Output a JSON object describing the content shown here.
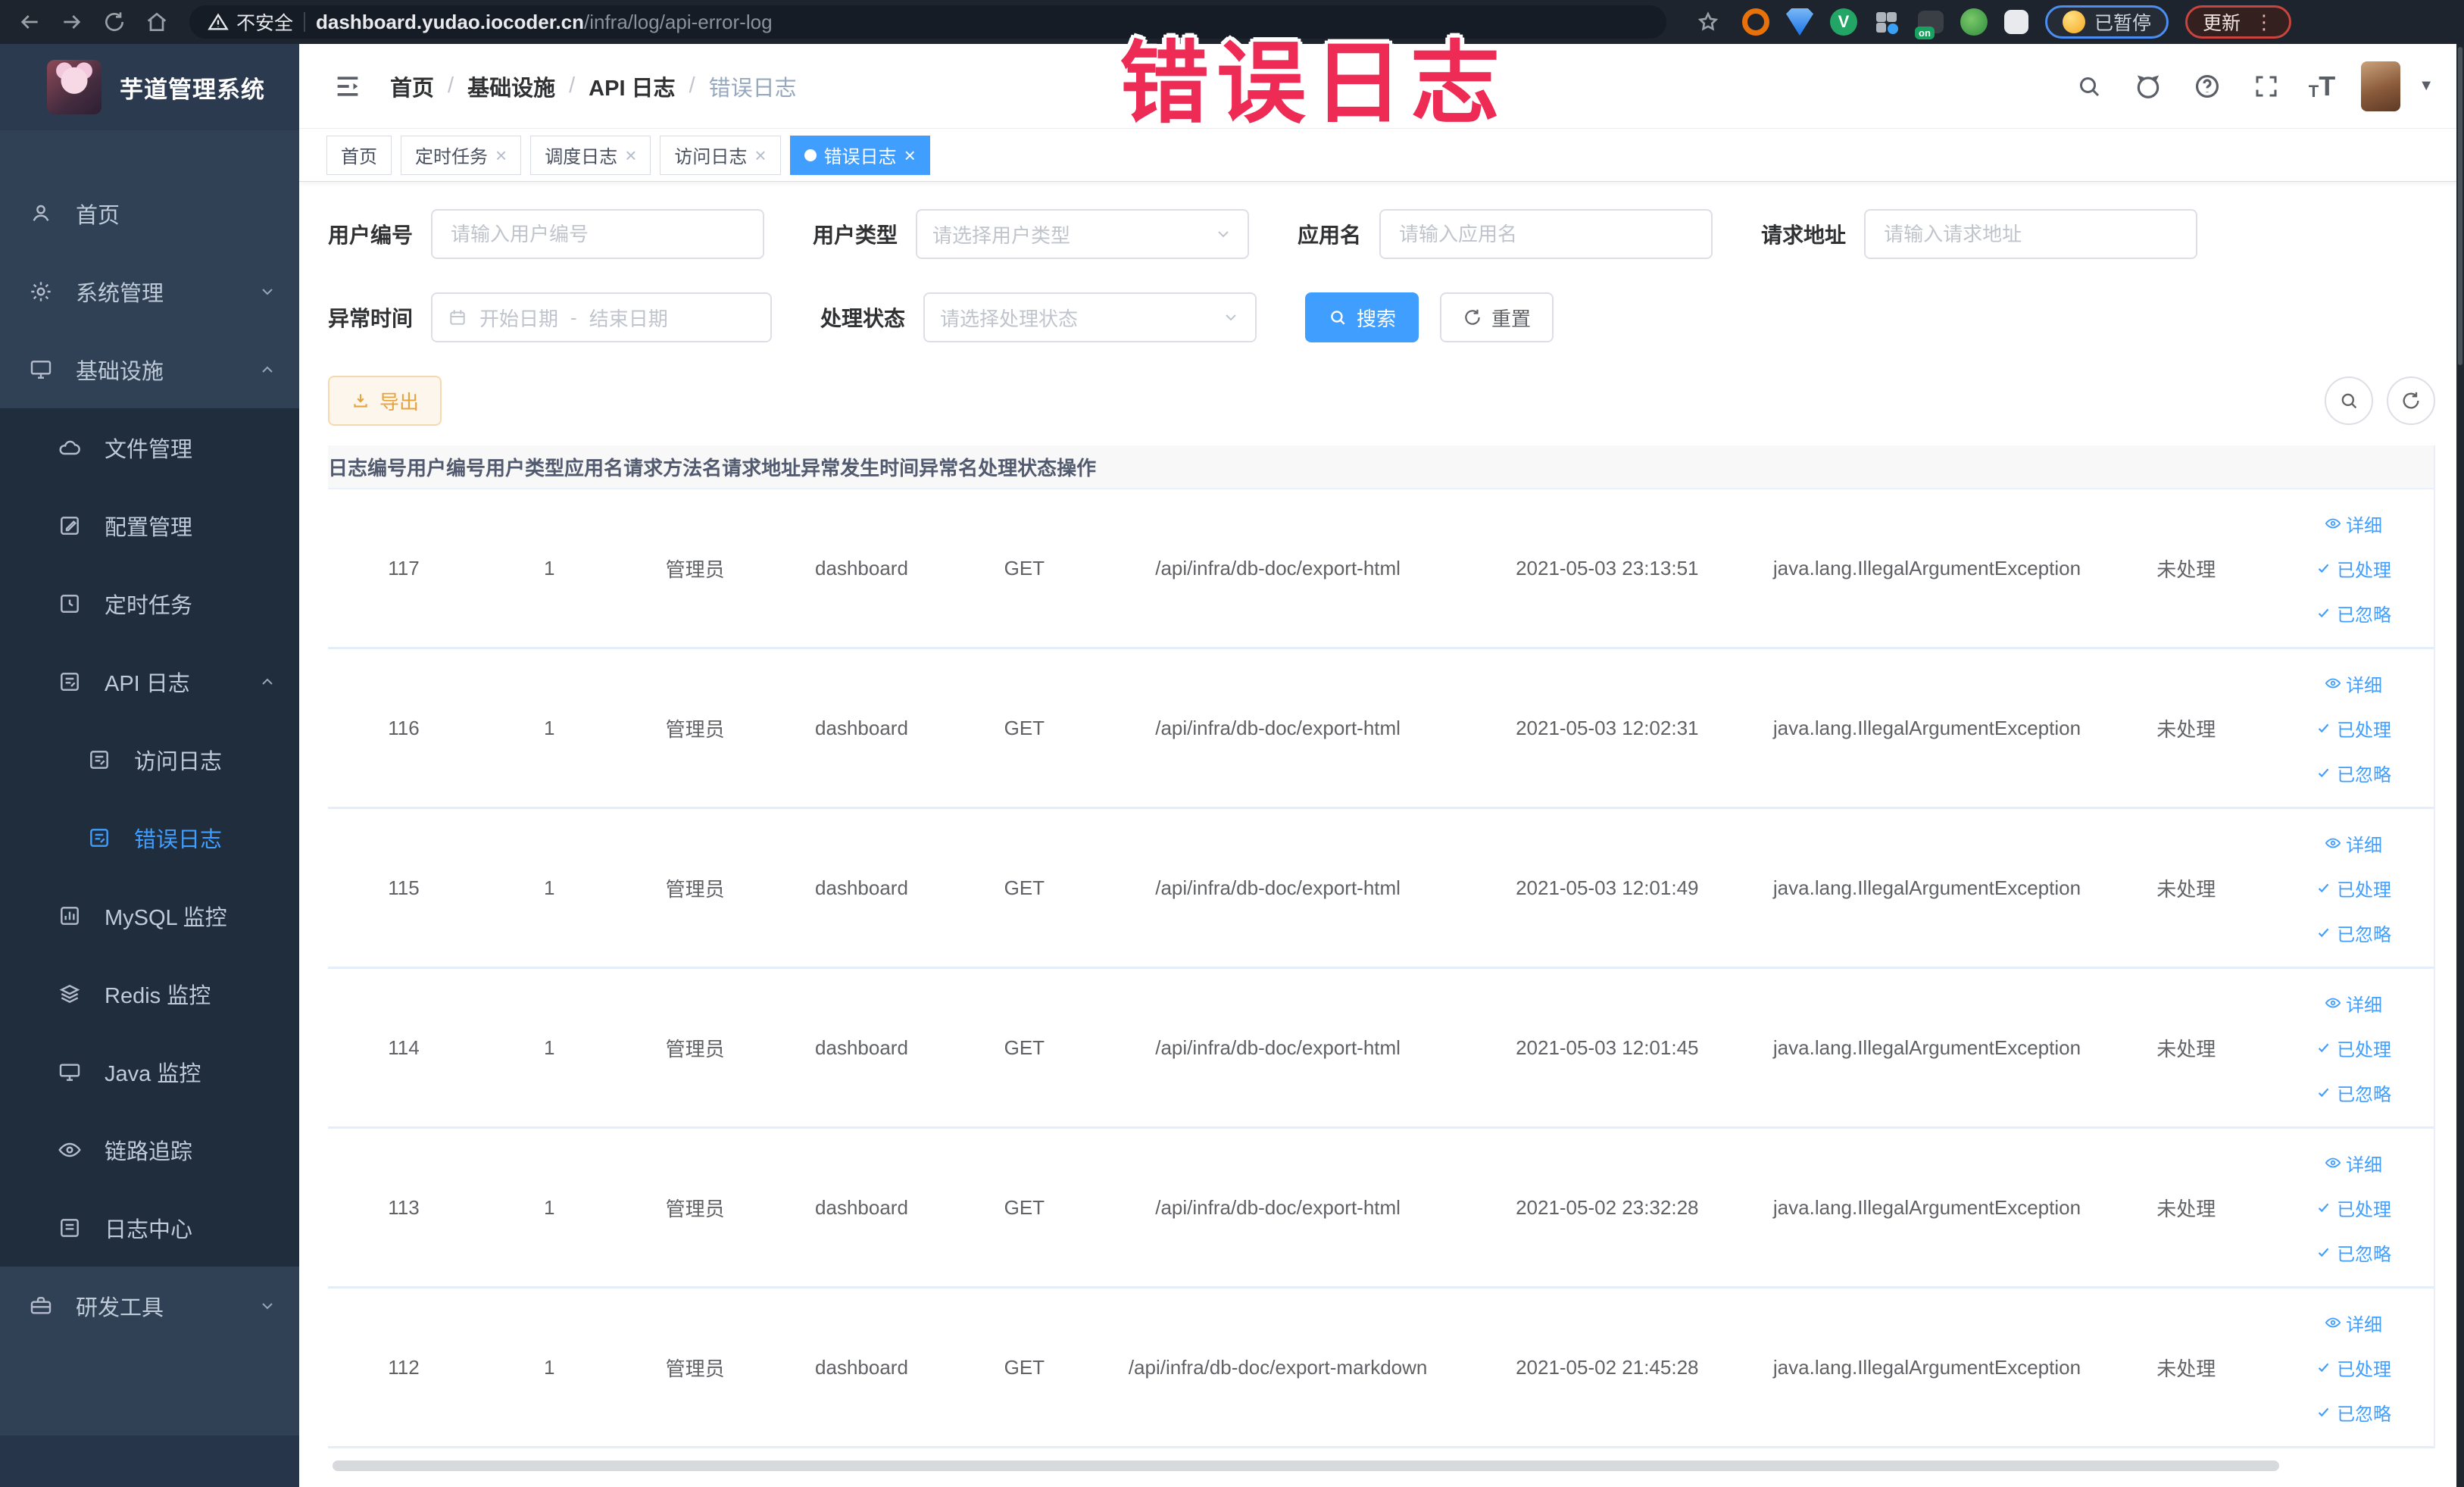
{
  "browser": {
    "security_label": "不安全",
    "url_host": "dashboard.yudao.iocoder.cn",
    "url_path": "/infra/log/api-error-log",
    "paused_badge": "已暂停",
    "update_button": "更新"
  },
  "overlay_title": "错误日志",
  "sidebar": {
    "app_title": "芋道管理系统",
    "items": [
      {
        "label": "首页"
      },
      {
        "label": "系统管理"
      },
      {
        "label": "基础设施"
      },
      {
        "label": "文件管理"
      },
      {
        "label": "配置管理"
      },
      {
        "label": "定时任务"
      },
      {
        "label": "API 日志"
      },
      {
        "label": "访问日志"
      },
      {
        "label": "错误日志"
      },
      {
        "label": "MySQL 监控"
      },
      {
        "label": "Redis 监控"
      },
      {
        "label": "Java 监控"
      },
      {
        "label": "链路追踪"
      },
      {
        "label": "日志中心"
      },
      {
        "label": "研发工具"
      }
    ]
  },
  "breadcrumb": [
    "首页",
    "基础设施",
    "API 日志",
    "错误日志"
  ],
  "tags": [
    {
      "label": "首页"
    },
    {
      "label": "定时任务"
    },
    {
      "label": "调度日志"
    },
    {
      "label": "访问日志"
    },
    {
      "label": "错误日志"
    }
  ],
  "filters": {
    "user_no_label": "用户编号",
    "user_no_placeholder": "请输入用户编号",
    "user_type_label": "用户类型",
    "user_type_placeholder": "请选择用户类型",
    "app_name_label": "应用名",
    "app_name_placeholder": "请输入应用名",
    "req_url_label": "请求地址",
    "req_url_placeholder": "请输入请求地址",
    "time_label": "异常时间",
    "time_start_placeholder": "开始日期",
    "time_separator": "-",
    "time_end_placeholder": "结束日期",
    "status_label": "处理状态",
    "status_placeholder": "请选择处理状态",
    "search_button": "搜索",
    "reset_button": "重置"
  },
  "toolbar": {
    "export_button": "导出"
  },
  "table": {
    "columns": [
      "日志编号",
      "用户编号",
      "用户类型",
      "应用名",
      "请求方法名",
      "请求地址",
      "异常发生时间",
      "异常名",
      "处理状态",
      "操作"
    ],
    "actions": {
      "detail": "详细",
      "processed": "已处理",
      "ignored": "已忽略"
    },
    "rows": [
      {
        "id": "117",
        "user_id": "1",
        "user_type": "管理员",
        "app": "dashboard",
        "method": "GET",
        "url": "/api/infra/db-doc/export-html",
        "time": "2021-05-03 23:13:51",
        "exception": "java.lang.IllegalArgumentException",
        "status": "未处理"
      },
      {
        "id": "116",
        "user_id": "1",
        "user_type": "管理员",
        "app": "dashboard",
        "method": "GET",
        "url": "/api/infra/db-doc/export-html",
        "time": "2021-05-03 12:02:31",
        "exception": "java.lang.IllegalArgumentException",
        "status": "未处理"
      },
      {
        "id": "115",
        "user_id": "1",
        "user_type": "管理员",
        "app": "dashboard",
        "method": "GET",
        "url": "/api/infra/db-doc/export-html",
        "time": "2021-05-03 12:01:49",
        "exception": "java.lang.IllegalArgumentException",
        "status": "未处理"
      },
      {
        "id": "114",
        "user_id": "1",
        "user_type": "管理员",
        "app": "dashboard",
        "method": "GET",
        "url": "/api/infra/db-doc/export-html",
        "time": "2021-05-03 12:01:45",
        "exception": "java.lang.IllegalArgumentException",
        "status": "未处理"
      },
      {
        "id": "113",
        "user_id": "1",
        "user_type": "管理员",
        "app": "dashboard",
        "method": "GET",
        "url": "/api/infra/db-doc/export-html",
        "time": "2021-05-02 23:32:28",
        "exception": "java.lang.IllegalArgumentException",
        "status": "未处理"
      },
      {
        "id": "112",
        "user_id": "1",
        "user_type": "管理员",
        "app": "dashboard",
        "method": "GET",
        "url": "/api/infra/db-doc/export-markdown",
        "time": "2021-05-02 21:45:28",
        "exception": "java.lang.IllegalArgumentException",
        "status": "未处理"
      }
    ]
  },
  "icons": {
    "not-secure": "warning-triangle",
    "search": "magnifier",
    "github": "octocat",
    "help": "question-circle",
    "fullscreen": "expand-arrows",
    "font-size": "T",
    "refresh": "circular-arrow",
    "export": "download-arrow",
    "detail": "eye",
    "processed": "check",
    "ignored": "check",
    "date": "calendar"
  },
  "colors": {
    "primary": "#409eff",
    "sidebar_bg": "#304156",
    "submenu_bg": "#1f2d3d",
    "warning": "#e6a23c",
    "overlay_red": "#ee2b55",
    "chrome_bg": "#1d242e"
  }
}
